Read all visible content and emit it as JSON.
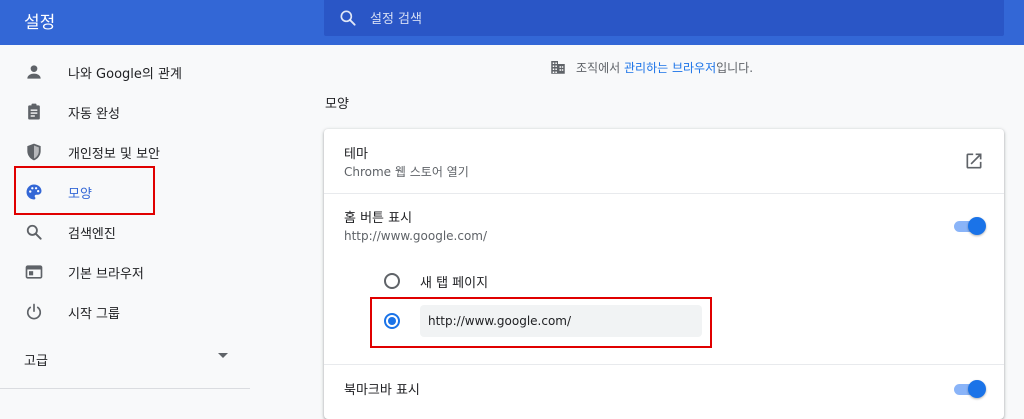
{
  "header": {
    "title": "설정",
    "search_placeholder": "설정 검색"
  },
  "sidebar": {
    "items": [
      {
        "label": "나와 Google의 관계",
        "icon": "person-icon"
      },
      {
        "label": "자동 완성",
        "icon": "clipboard-icon"
      },
      {
        "label": "개인정보 및 보안",
        "icon": "shield-icon"
      },
      {
        "label": "모양",
        "icon": "palette-icon",
        "active": true
      },
      {
        "label": "검색엔진",
        "icon": "search-icon"
      },
      {
        "label": "기본 브라우저",
        "icon": "browser-icon"
      },
      {
        "label": "시작 그룹",
        "icon": "power-icon"
      }
    ],
    "advanced_label": "고급"
  },
  "managed": {
    "prefix": "조직에서 ",
    "link": "관리하는 브라우저",
    "suffix": "입니다."
  },
  "appearance": {
    "section_title": "모양",
    "theme": {
      "title": "테마",
      "subtitle": "Chrome 웹 스토어 열기"
    },
    "home_button": {
      "title": "홈 버튼 표시",
      "subtitle": "http://www.google.com/",
      "enabled": true,
      "option_new_tab": "새 탭 페이지",
      "custom_url_value": "http://www.google.com/"
    },
    "bookmarks_bar": {
      "title": "북마크바 표시",
      "enabled": true
    }
  },
  "colors": {
    "header": "#3367d6",
    "accent": "#1a73e8",
    "highlight": "#e00000"
  }
}
